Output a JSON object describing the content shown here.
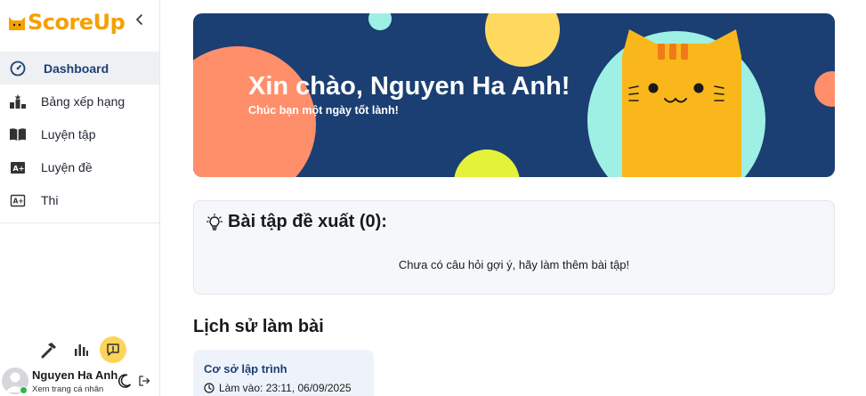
{
  "app": {
    "logo_text": "ScoreUp"
  },
  "sidebar": {
    "items": [
      {
        "label": "Dashboard",
        "icon": "gauge-icon",
        "active": true
      },
      {
        "label": "Bảng xếp hạng",
        "icon": "podium-icon"
      },
      {
        "label": "Luyện tập",
        "icon": "book-icon"
      },
      {
        "label": "Luyện đề",
        "icon": "exam-icon"
      },
      {
        "label": "Thi",
        "icon": "test-icon"
      }
    ],
    "tools": [
      "hammer-icon",
      "bar-chart-icon",
      "feedback-icon"
    ],
    "user": {
      "name": "Nguyen Ha Anh",
      "subtitle": "Xem trang cá nhân",
      "status": "online"
    }
  },
  "banner": {
    "title": "Xin chào, Nguyen Ha Anh!",
    "subtitle": "Chúc bạn một ngày tốt lành!"
  },
  "suggestions": {
    "title": "Bài tập đề xuất (0):",
    "empty_text": "Chưa có câu hỏi gợi ý, hãy làm thêm bài tập!"
  },
  "history": {
    "title": "Lịch sử làm bài",
    "items": [
      {
        "title": "Cơ sở lập trình",
        "time": "Làm vào: 23:11, 06/09/2025"
      }
    ]
  },
  "colors": {
    "brand": "#f5a000",
    "navy": "#1b3f72",
    "accent_yellow": "#fcd45a",
    "active_bg": "#eef0f3"
  }
}
